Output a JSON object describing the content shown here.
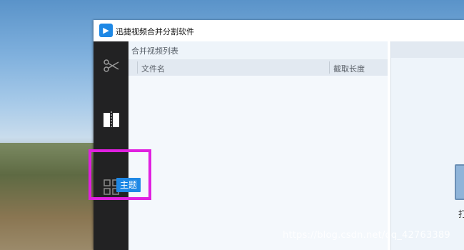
{
  "window": {
    "title": "迅捷视频合并分割软件"
  },
  "sidebar": {
    "items": [
      {
        "name": "cut",
        "icon": "scissors-icon"
      },
      {
        "name": "merge",
        "icon": "merge-icon"
      },
      {
        "name": "theme",
        "icon": "grid-icon",
        "tooltip": "主题"
      }
    ]
  },
  "panel": {
    "title": "合并视频列表",
    "columns": [
      "文件名",
      "截取长度"
    ]
  },
  "right_panel": {
    "partial_char": "打"
  },
  "watermark": "https://blog.csdn.net/qq_42763389",
  "colors": {
    "accent": "#1e88e5",
    "highlight": "#e020e0",
    "sidebar_bg": "#222223"
  }
}
